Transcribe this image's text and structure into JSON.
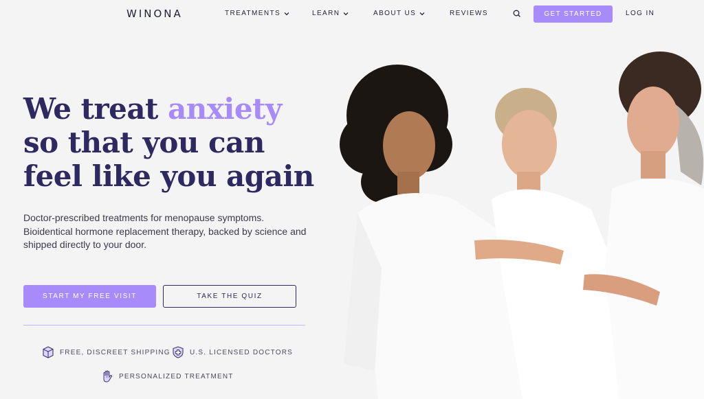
{
  "header": {
    "logo": "WINONA",
    "nav": [
      {
        "label": "TREATMENTS",
        "has_dropdown": true
      },
      {
        "label": "LEARN",
        "has_dropdown": true
      },
      {
        "label": "ABOUT US",
        "has_dropdown": true
      },
      {
        "label": "REVIEWS",
        "has_dropdown": false
      }
    ],
    "search_icon": "search-icon",
    "cta_label": "GET STARTED",
    "login_label": "LOG IN"
  },
  "hero": {
    "headline_part1": "We treat ",
    "headline_accent": "anxiety",
    "headline_part2": " so that you can feel like you again.",
    "subtext": "Doctor-prescribed treatments for menopause symptoms. Bioidentical hormone replacement therapy, backed by science and shipped directly to your door.",
    "primary_button": "START MY FREE VISIT",
    "secondary_button": "TAKE THE QUIZ"
  },
  "features": [
    {
      "label": "FREE, DISCREET SHIPPING",
      "icon": "box-icon"
    },
    {
      "label": "U.S. LICENSED DOCTORS",
      "icon": "shield-cross-icon"
    },
    {
      "label": "PERSONALIZED TREATMENT",
      "icon": "hand-heart-icon"
    }
  ],
  "colors": {
    "accent": "#a78bfa",
    "heading": "#2e2960",
    "background": "#f4f4f5"
  }
}
